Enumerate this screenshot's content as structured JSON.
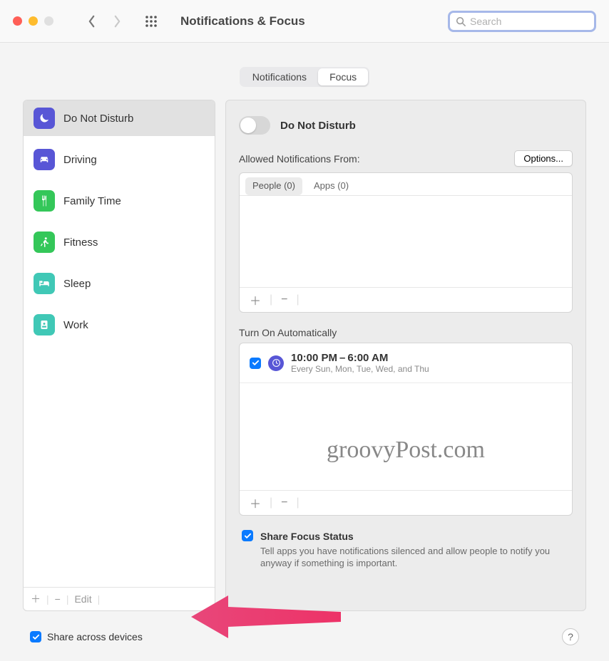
{
  "toolbar": {
    "title": "Notifications & Focus",
    "search_placeholder": "Search"
  },
  "tabs": {
    "notifications": "Notifications",
    "focus": "Focus",
    "active": "focus"
  },
  "sidebar": {
    "items": [
      {
        "label": "Do Not Disturb",
        "icon": "moon",
        "color": "#5856d6"
      },
      {
        "label": "Driving",
        "icon": "car",
        "color": "#5856d6"
      },
      {
        "label": "Family Time",
        "icon": "fork-knife",
        "color": "#34c759"
      },
      {
        "label": "Fitness",
        "icon": "running",
        "color": "#34c759"
      },
      {
        "label": "Sleep",
        "icon": "bed",
        "color": "#40c8b6"
      },
      {
        "label": "Work",
        "icon": "badge",
        "color": "#40c8b6"
      }
    ],
    "selected_index": 0,
    "footer_edit": "Edit"
  },
  "right": {
    "toggle_label": "Do Not Disturb",
    "toggle_on": false,
    "allowed_label": "Allowed Notifications From:",
    "options_label": "Options...",
    "allowed_tabs": {
      "people": "People (0)",
      "apps": "Apps (0)",
      "active": "people"
    },
    "auto_label": "Turn On Automatically",
    "schedule": {
      "enabled": true,
      "time": "10:00 PM – 6:00 AM",
      "days": "Every Sun, Mon, Tue, Wed, and Thu"
    },
    "share_status": {
      "enabled": true,
      "label": "Share Focus Status",
      "description": "Tell apps you have notifications silenced and allow people to notify you anyway if something is important."
    }
  },
  "bottom": {
    "share_devices_enabled": true,
    "share_devices_label": "Share across devices",
    "help": "?"
  },
  "watermark": "groovyPost.com"
}
